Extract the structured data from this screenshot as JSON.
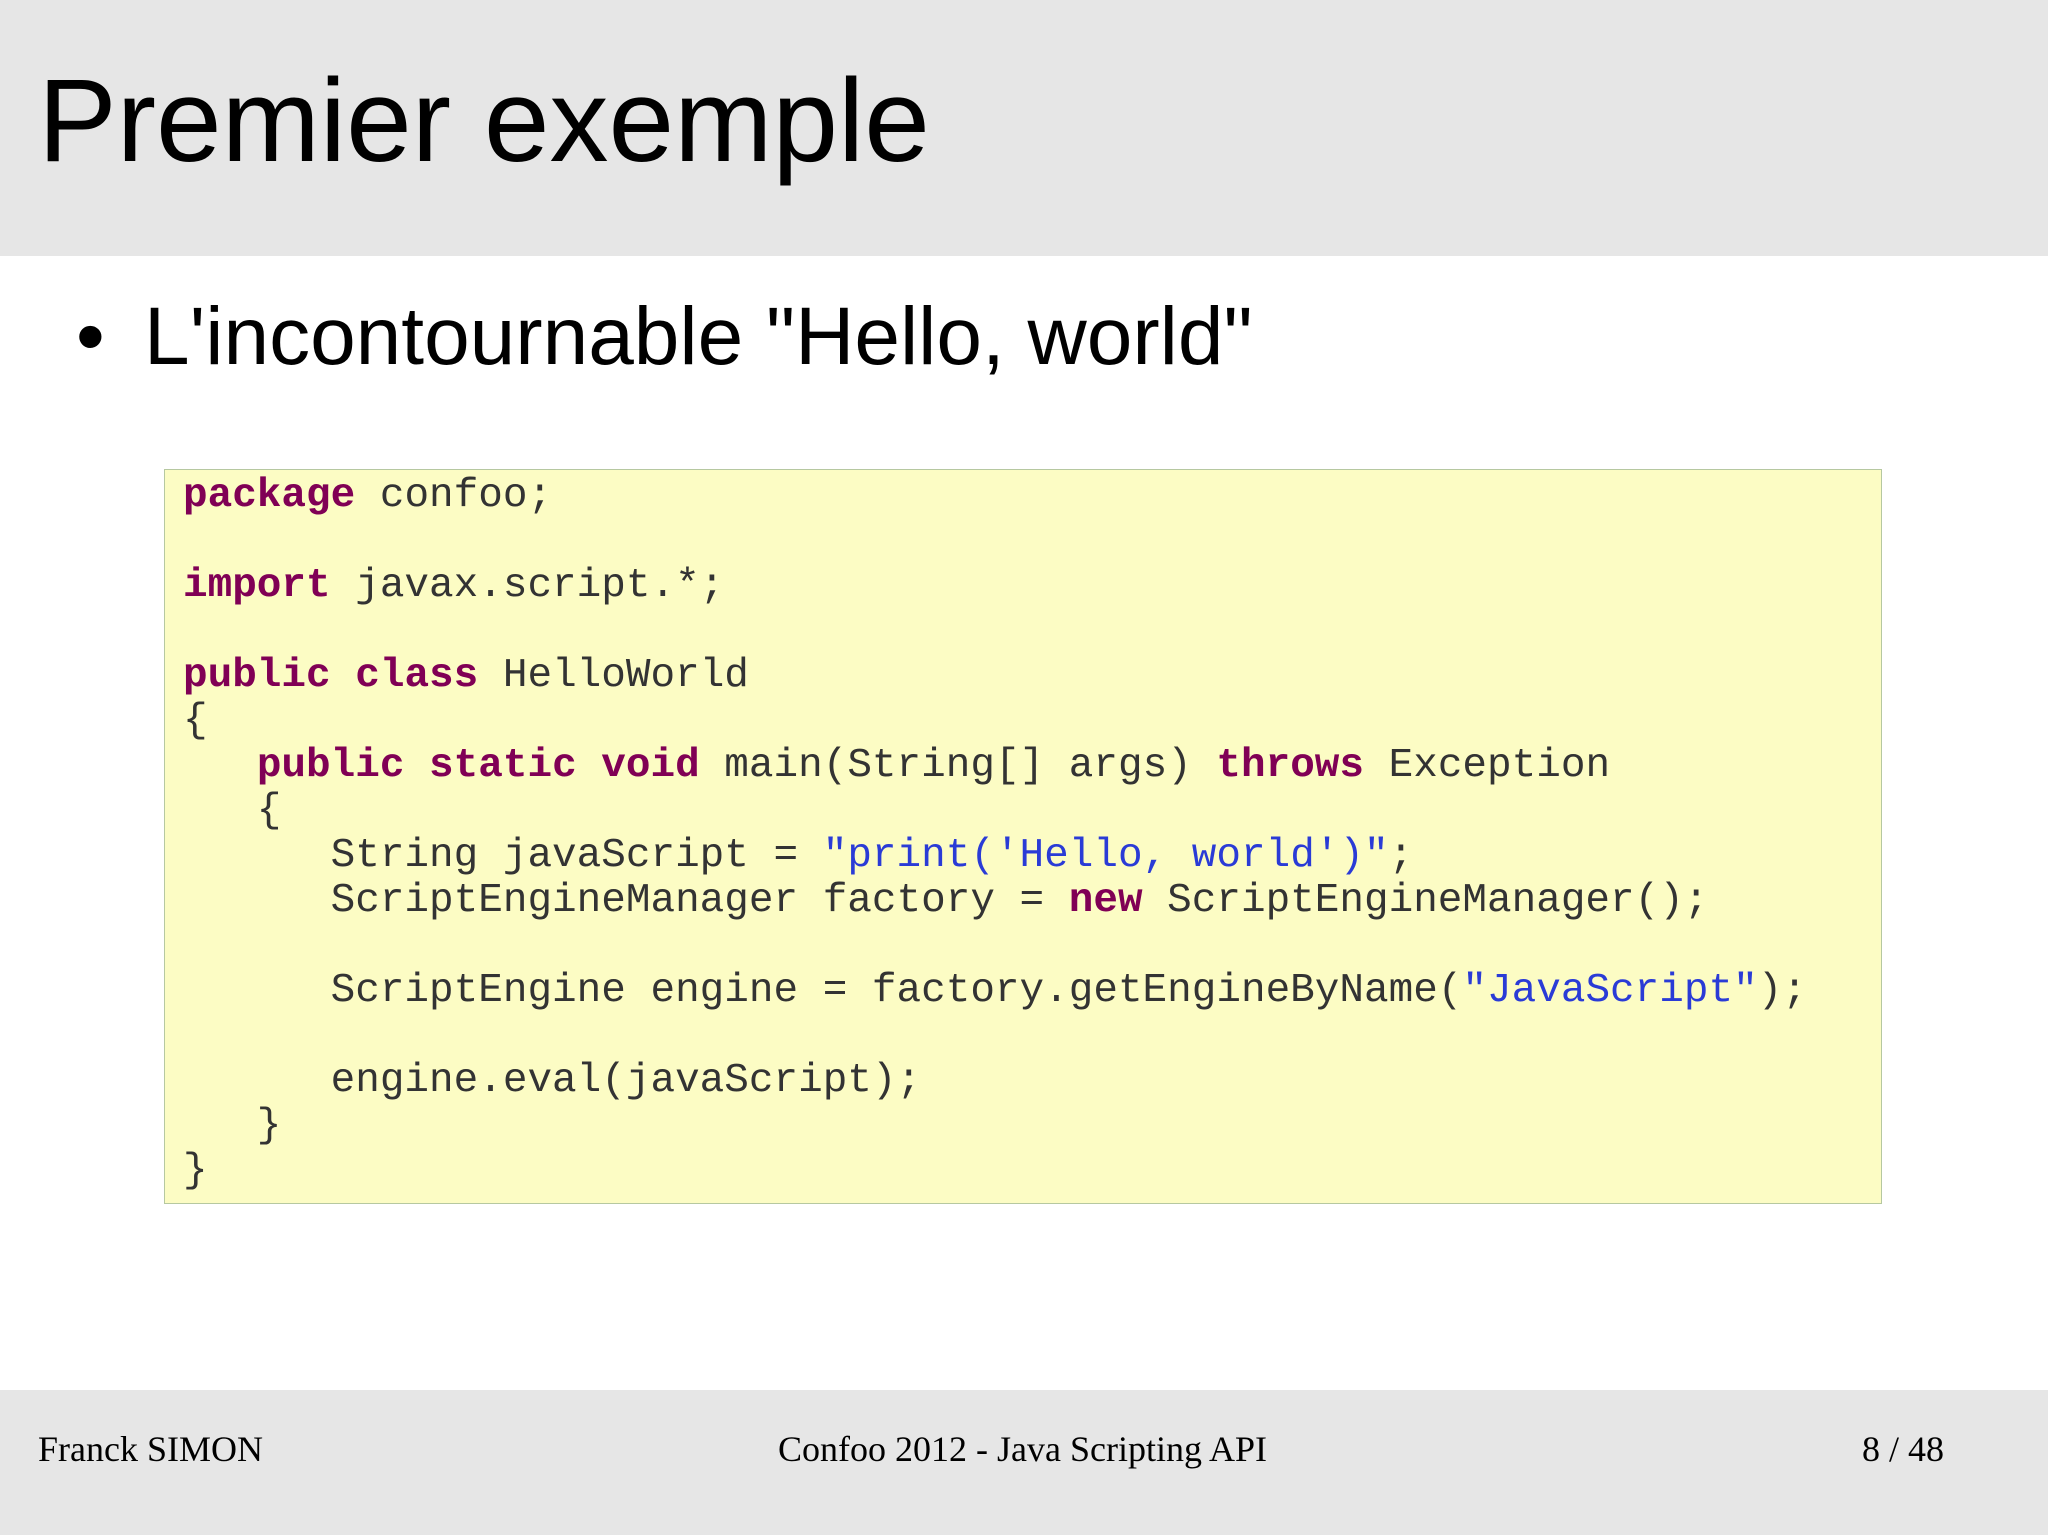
{
  "slide": {
    "title": "Premier exemple",
    "bullet": "L'incontournable \"Hello, world\""
  },
  "code": {
    "language": "java",
    "colors": {
      "background": "#fcfcc4",
      "keyword": "#800055",
      "string": "#2a3bd6",
      "text": "#333333"
    },
    "lines": [
      [
        {
          "t": "package",
          "k": "kw"
        },
        {
          "t": " confoo;"
        }
      ],
      [],
      [
        {
          "t": "import",
          "k": "kw"
        },
        {
          "t": " javax.script.*;"
        }
      ],
      [],
      [
        {
          "t": "public",
          "k": "kw"
        },
        {
          "t": " "
        },
        {
          "t": "class",
          "k": "kw"
        },
        {
          "t": " HelloWorld"
        }
      ],
      [
        {
          "t": "{"
        }
      ],
      [
        {
          "t": "   "
        },
        {
          "t": "public",
          "k": "kw"
        },
        {
          "t": " "
        },
        {
          "t": "static",
          "k": "kw"
        },
        {
          "t": " "
        },
        {
          "t": "void",
          "k": "kw"
        },
        {
          "t": " main(String[] args) "
        },
        {
          "t": "throws",
          "k": "kw"
        },
        {
          "t": " Exception"
        }
      ],
      [
        {
          "t": "   {"
        }
      ],
      [
        {
          "t": "      String javaScript = "
        },
        {
          "t": "\"print('Hello, world')\"",
          "k": "str"
        },
        {
          "t": ";"
        }
      ],
      [
        {
          "t": "      ScriptEngineManager factory = "
        },
        {
          "t": "new",
          "k": "kw"
        },
        {
          "t": " ScriptEngineManager();"
        }
      ],
      [],
      [
        {
          "t": "      ScriptEngine engine = factory.getEngineByName("
        },
        {
          "t": "\"JavaScript\"",
          "k": "str"
        },
        {
          "t": ");"
        }
      ],
      [],
      [
        {
          "t": "      engine.eval(javaScript);"
        }
      ],
      [
        {
          "t": "   }"
        }
      ],
      [
        {
          "t": "}"
        }
      ]
    ]
  },
  "footer": {
    "author": "Franck SIMON",
    "event": "Confoo 2012 - Java Scripting API",
    "page": "8 / 48"
  }
}
